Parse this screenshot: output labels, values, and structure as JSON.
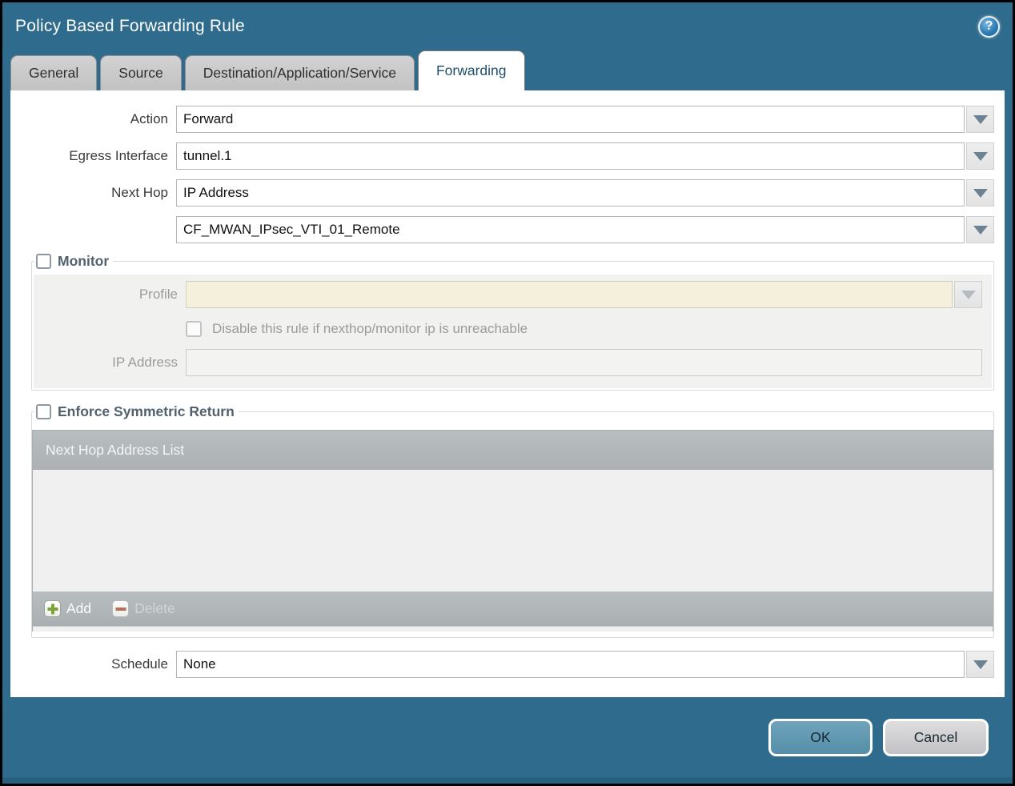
{
  "dialog": {
    "title": "Policy Based Forwarding Rule"
  },
  "tabs": [
    {
      "label": "General",
      "active": false
    },
    {
      "label": "Source",
      "active": false
    },
    {
      "label": "Destination/Application/Service",
      "active": false
    },
    {
      "label": "Forwarding",
      "active": true
    }
  ],
  "form": {
    "action": {
      "label": "Action",
      "value": "Forward"
    },
    "egress_interface": {
      "label": "Egress Interface",
      "value": "tunnel.1"
    },
    "next_hop": {
      "label": "Next Hop",
      "value": "IP Address"
    },
    "next_hop_address": {
      "value": "CF_MWAN_IPsec_VTI_01_Remote"
    },
    "schedule": {
      "label": "Schedule",
      "value": "None"
    }
  },
  "monitor": {
    "legend": "Monitor",
    "checked": false,
    "profile": {
      "label": "Profile",
      "value": ""
    },
    "disable_rule": {
      "label": "Disable this rule if nexthop/monitor ip is unreachable",
      "checked": false
    },
    "ip_address": {
      "label": "IP Address",
      "value": ""
    }
  },
  "symmetric_return": {
    "legend": "Enforce Symmetric Return",
    "checked": false,
    "list": {
      "header": "Next Hop Address List",
      "rows": [],
      "add_label": "Add",
      "delete_label": "Delete"
    }
  },
  "footer": {
    "ok_label": "OK",
    "cancel_label": "Cancel"
  },
  "icons": {
    "help": "?",
    "dropdown": "▼",
    "add": "+",
    "delete": "−"
  },
  "colors": {
    "titlebar_bg": "#2F6B8C",
    "ok_button_bg": "#5E93AD",
    "cancel_button_bg": "#C8C8CC",
    "disabled_field_bg": "#F5F0DC",
    "list_bar_bg": "#B2B7B9",
    "add_icon_green": "#7DA33C",
    "delete_icon_red": "#B5705C",
    "legend_text": "#52616D"
  }
}
